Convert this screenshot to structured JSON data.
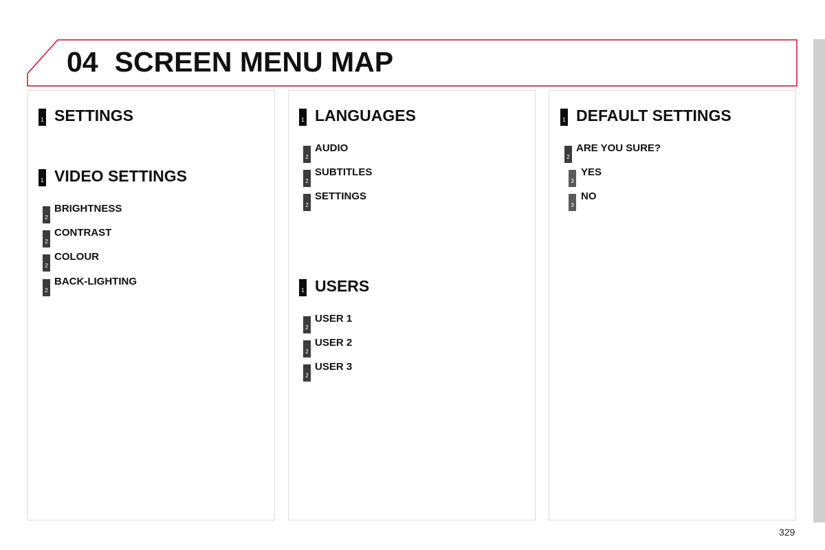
{
  "header": {
    "section_number": "04",
    "title": "SCREEN MENU MAP",
    "accent_color": "#c8102e"
  },
  "panels": [
    {
      "groups": [
        {
          "level": 1,
          "label": "SETTINGS",
          "items": []
        },
        {
          "level": 1,
          "label": "VIDEO SETTINGS",
          "items": [
            {
              "level": 2,
              "label": "BRIGHTNESS"
            },
            {
              "level": 2,
              "label": "CONTRAST"
            },
            {
              "level": 2,
              "label": "COLOUR"
            },
            {
              "level": 2,
              "label": "BACK-LIGHTING"
            }
          ]
        }
      ]
    },
    {
      "groups": [
        {
          "level": 1,
          "label": "LANGUAGES",
          "items": [
            {
              "level": 2,
              "label": "AUDIO"
            },
            {
              "level": 2,
              "label": "SUBTITLES"
            },
            {
              "level": 2,
              "label": "SETTINGS"
            }
          ]
        },
        {
          "level": 1,
          "label": "USERS",
          "items": [
            {
              "level": 2,
              "label": "USER 1"
            },
            {
              "level": 2,
              "label": "USER 2"
            },
            {
              "level": 2,
              "label": "USER 3"
            }
          ]
        }
      ]
    },
    {
      "groups": [
        {
          "level": 1,
          "label": "DEFAULT SETTINGS",
          "items": [
            {
              "level": 2,
              "label": "ARE YOU SURE?"
            },
            {
              "level": 3,
              "label": "YES"
            },
            {
              "level": 3,
              "label": "NO"
            }
          ]
        }
      ]
    }
  ],
  "level_badges": {
    "1": "1",
    "2": "2",
    "3": "3"
  },
  "page_number": "329"
}
